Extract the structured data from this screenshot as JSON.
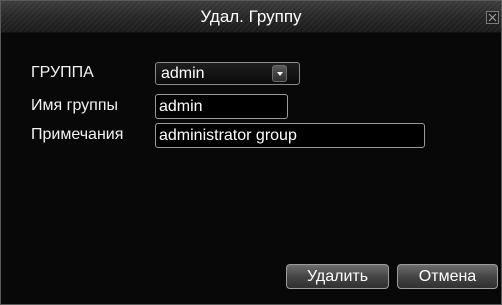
{
  "dialog": {
    "title": "Удал. Группу",
    "close_icon": "close-icon"
  },
  "form": {
    "group_label": "ГРУППА",
    "group_value": "admin",
    "group_name_label": "Имя группы",
    "group_name_value": "admin",
    "notes_label": "Примечания",
    "notes_value": "administrator group"
  },
  "buttons": {
    "delete_label": "Удалить",
    "cancel_label": "Отмена"
  },
  "colors": {
    "background": "#080808",
    "text": "#f2f2f2",
    "field_border": "#9a9a9a"
  }
}
